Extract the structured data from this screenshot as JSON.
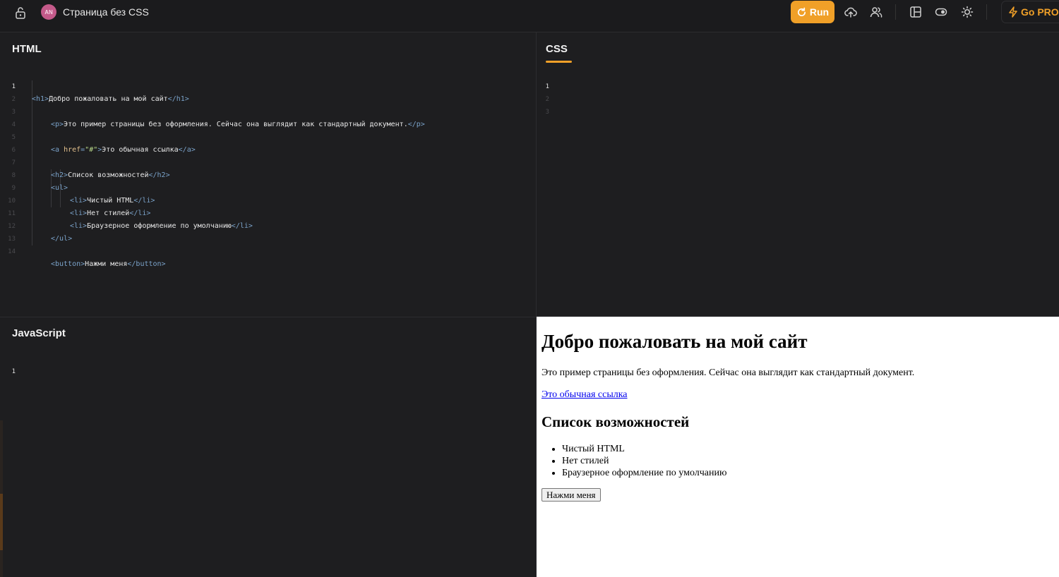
{
  "header": {
    "avatar_initials": "AN",
    "project_title": "Страница без CSS",
    "run_label": "Run",
    "gopro_label": "Go PRO",
    "accent_color": "#f0a028"
  },
  "icons": [
    "lock-icon",
    "refresh-icon",
    "cloud-upload-icon",
    "users-icon",
    "layout-icon",
    "toggle-icon",
    "sun-icon",
    "bolt-icon"
  ],
  "panes": {
    "html_label": "HTML",
    "css_label": "CSS",
    "js_label": "JavaScript"
  },
  "html_code": {
    "line_numbers": [
      "1",
      "2",
      "3",
      "4",
      "5",
      "6",
      "7",
      "8",
      "9",
      "10",
      "11",
      "12",
      "13",
      "14"
    ],
    "l1_text": "Добро пожаловать на мой сайт",
    "l3_text": "Это пример страницы без оформления. Сейчас она выглядит как стандартный документ.",
    "l5_attr": "href",
    "l5_value": "\"#\"",
    "l5_text": "Это обычная ссылка",
    "l7_text": "Список возможностей",
    "l9_text": "Чистый HTML",
    "l10_text": "Нет стилей",
    "l11_text": "Браузерное оформление по умолчанию",
    "l14_text": "Нажми меня"
  },
  "css_code": {
    "line_numbers": [
      "1",
      "2",
      "3"
    ]
  },
  "js_code": {
    "line_numbers": [
      "1"
    ]
  },
  "preview": {
    "h1": "Добро пожаловать на мой сайт",
    "p": "Это пример страницы без оформления. Сейчас она выглядит как стандартный документ.",
    "link": "Это обычная ссылка",
    "h2": "Список возможностей",
    "list": [
      "Чистый HTML",
      "Нет стилей",
      "Браузерное оформление по умолчанию"
    ],
    "button": "Нажми меня"
  }
}
